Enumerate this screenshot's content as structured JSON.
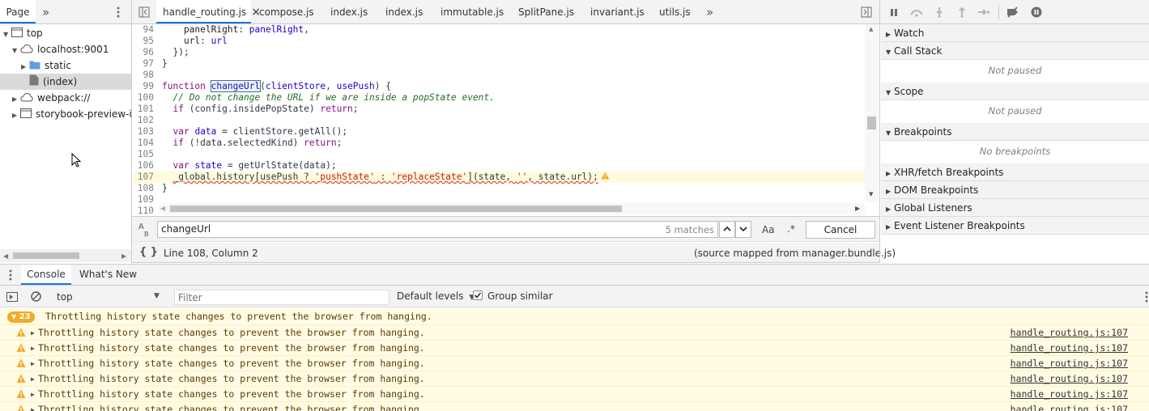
{
  "navigator": {
    "tab_label": "Page",
    "more_glyph": "»",
    "tree": [
      {
        "label": "top",
        "level": 0,
        "expanded": true
      },
      {
        "label": "localhost:9001",
        "level": 1,
        "expanded": true
      },
      {
        "label": "static",
        "level": 2,
        "expanded": false
      },
      {
        "label": "(index)",
        "level": 2,
        "selected": true
      },
      {
        "label": "webpack://",
        "level": 1,
        "expanded": false
      },
      {
        "label": "storybook-preview-ifr",
        "level": 1,
        "expanded": false
      }
    ]
  },
  "editor": {
    "tabs": [
      {
        "label": "handle_routing.js",
        "active": true,
        "close": "×"
      },
      {
        "label": "compose.js"
      },
      {
        "label": "index.js"
      },
      {
        "label": "index.js"
      },
      {
        "label": "immutable.js"
      },
      {
        "label": "SplitPane.js"
      },
      {
        "label": "invariant.js"
      },
      {
        "label": "utils.js"
      }
    ],
    "more_glyph": "»",
    "lines": [
      {
        "n": "94",
        "html": "    <span class='prop'>panelRight</span>: <span class='var'>panelRight</span>,"
      },
      {
        "n": "95",
        "html": "    <span class='prop'>url</span>: <span class='var'>url</span>"
      },
      {
        "n": "96",
        "html": "  });"
      },
      {
        "n": "97",
        "html": "}"
      },
      {
        "n": "98",
        "html": ""
      },
      {
        "n": "99",
        "html": "<span class='kw2'>function</span> <span class='fn' style='outline:1px solid #4a6f9a;background:#e8f0fe;'>changeUrl</span>(<span class='var'>clientStore</span>, <span class='var'>usePush</span>) {"
      },
      {
        "n": "100",
        "html": "  <span class='cm'>// Do not change the URL if we are inside a popState event.</span>"
      },
      {
        "n": "101",
        "html": "  <span class='kw2'>if</span> (config.insidePopState) <span class='kw2'>return</span>;"
      },
      {
        "n": "102",
        "html": ""
      },
      {
        "n": "103",
        "html": "  <span class='kw2'>var</span> <span class='var'>data</span> = clientStore.getAll();"
      },
      {
        "n": "104",
        "html": "  <span class='kw2'>if</span> (!data.selectedKind) <span class='kw2'>return</span>;"
      },
      {
        "n": "105",
        "html": ""
      },
      {
        "n": "106",
        "html": "  <span class='kw2'>var</span> <span class='var'>state</span> = getUrlState(data);"
      },
      {
        "n": "107",
        "html": "  <span class='squig'>_global.history[usePush ? <span class='str'>'pushState'</span> : <span class='str'>'replaceState'</span>](state, <span class='str'>''</span>, state.url);</span>",
        "highlight": true
      },
      {
        "n": "108",
        "html": "}"
      },
      {
        "n": "109",
        "html": ""
      },
      {
        "n": "110",
        "html": ""
      }
    ]
  },
  "search": {
    "value": "changeUrl",
    "matches": "5 matches",
    "case_label": "Aa",
    "regex_label": ".*",
    "cancel_label": "Cancel"
  },
  "status": {
    "format_glyph": "{ }",
    "position": "Line 108, Column 2",
    "source_mapped": "(source mapped from manager.bundle.js)"
  },
  "debugger": {
    "sections": [
      {
        "label": "Watch",
        "expanded": false
      },
      {
        "label": "Call Stack",
        "expanded": true,
        "note": "Not paused"
      },
      {
        "label": "Scope",
        "expanded": true,
        "note": "Not paused"
      },
      {
        "label": "Breakpoints",
        "expanded": true,
        "note": "No breakpoints"
      },
      {
        "label": "XHR/fetch Breakpoints",
        "expanded": false
      },
      {
        "label": "DOM Breakpoints",
        "expanded": false
      },
      {
        "label": "Global Listeners",
        "expanded": false
      },
      {
        "label": "Event Listener Breakpoints",
        "expanded": false
      }
    ]
  },
  "drawer": {
    "tabs": [
      {
        "label": "Console",
        "active": true
      },
      {
        "label": "What's New"
      }
    ],
    "context": "top",
    "filter_placeholder": "Filter",
    "levels": "Default levels",
    "group_similar": "Group similar",
    "group_count": "23",
    "group_text": "Throttling history state changes to prevent the browser from hanging.",
    "messages": [
      {
        "text": "Throttling history state changes to prevent the browser from hanging.",
        "source": "handle_routing.js:107"
      },
      {
        "text": "Throttling history state changes to prevent the browser from hanging.",
        "source": "handle_routing.js:107"
      },
      {
        "text": "Throttling history state changes to prevent the browser from hanging.",
        "source": "handle_routing.js:107"
      },
      {
        "text": "Throttling history state changes to prevent the browser from hanging.",
        "source": "handle_routing.js:107"
      },
      {
        "text": "Throttling history state changes to prevent the browser from hanging.",
        "source": "handle_routing.js:107"
      },
      {
        "text": "Throttling history state changes to prevent the browser from hanging.",
        "source": "handle_routing.js:107"
      }
    ]
  },
  "colors": {
    "accent": "#1a73e8",
    "warning_bg": "#fffbe5",
    "warning_icon": "#f2ab26",
    "folder": "#5e9ce6"
  }
}
